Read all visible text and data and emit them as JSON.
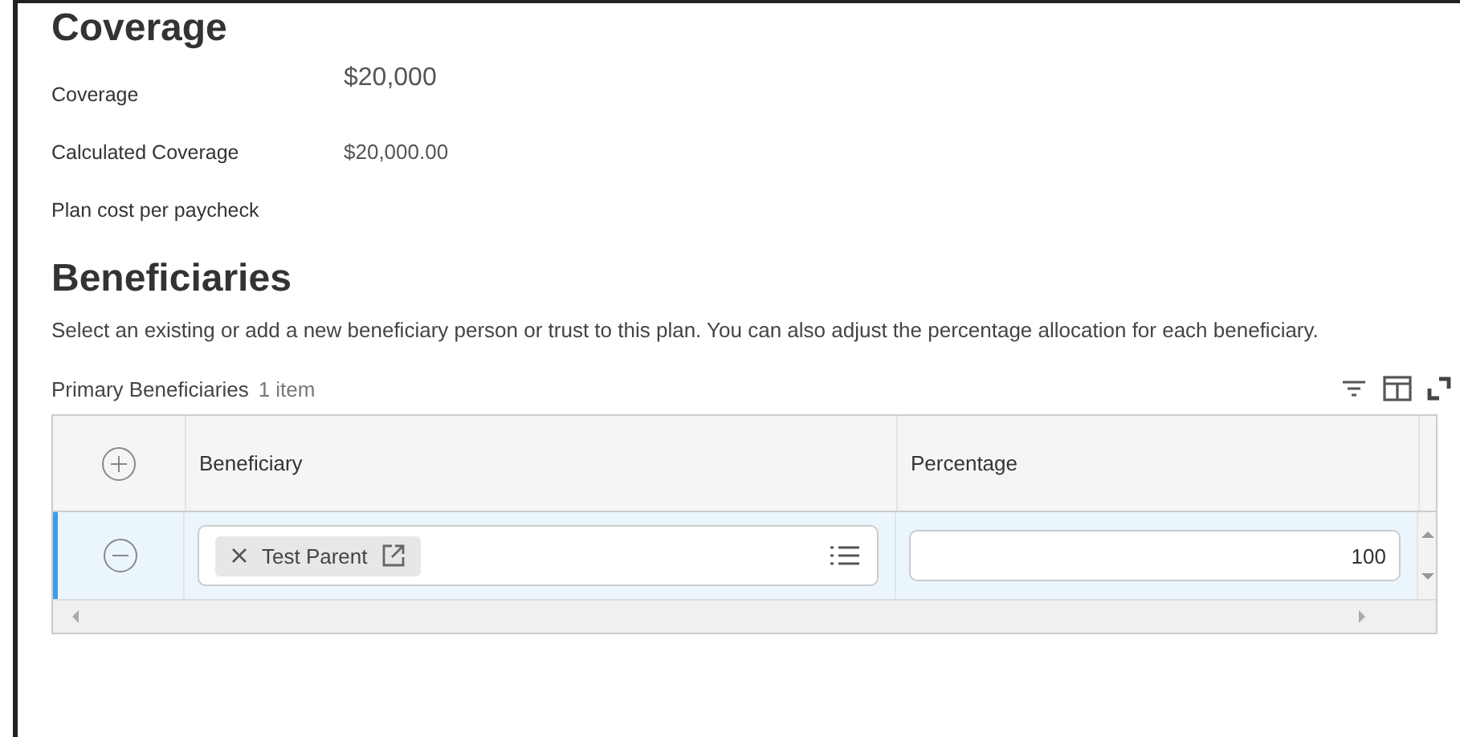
{
  "coverage": {
    "title": "Coverage",
    "fields": [
      {
        "label": "Coverage",
        "value": "$20,000",
        "kind": "large"
      },
      {
        "label": "Calculated Coverage",
        "value": "$20,000.00",
        "kind": "normal"
      },
      {
        "label": "Plan cost per paycheck",
        "kind": "normal"
      }
    ]
  },
  "beneficiaries": {
    "title": "Beneficiaries",
    "description": "Select an existing or add a new beneficiary person or trust to this plan. You can also adjust the percentage allocation for each beneficiary.",
    "grid": {
      "title": "Primary Beneficiaries",
      "count": "1 item",
      "columns": [
        "Beneficiary",
        "Percentage"
      ],
      "rows": [
        {
          "selected": true,
          "beneficiary": "Test Parent",
          "percentage": "100"
        }
      ]
    }
  }
}
